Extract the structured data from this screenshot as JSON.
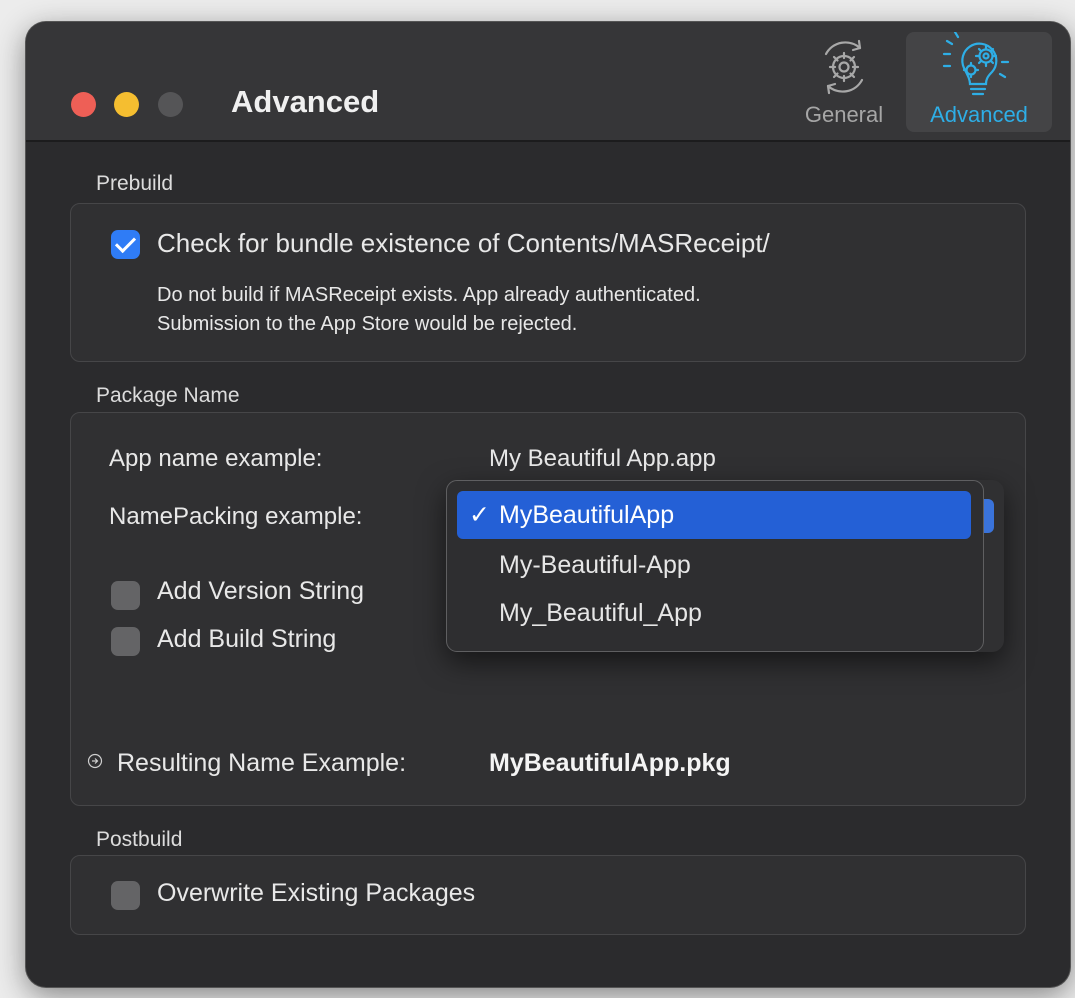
{
  "window": {
    "title": "Advanced",
    "toolbar": [
      {
        "label": "General",
        "icon": "gear-cycle-icon",
        "selected": false
      },
      {
        "label": "Advanced",
        "icon": "lightbulb-gears-icon",
        "selected": true
      }
    ],
    "accent": "#2eaee6"
  },
  "prebuild": {
    "section_label": "Prebuild",
    "check_bundle": {
      "label": "Check for bundle existence of Contents/MASReceipt/",
      "checked": true
    },
    "description_line1": "Do not build if MASReceipt exists. App already authenticated.",
    "description_line2": "Submission to the App Store would be rejected."
  },
  "package_name": {
    "section_label": "Package Name",
    "app_name_label": "App name example:",
    "app_name_value": "My Beautiful App.app",
    "name_packing_label": "NamePacking example:",
    "name_packing_options": [
      {
        "label": "MyBeautifulApp",
        "selected": true
      },
      {
        "label": "My-Beautiful-App",
        "selected": false
      },
      {
        "label": "My_Beautiful_App",
        "selected": false
      }
    ],
    "checkmark": "✓",
    "add_version": {
      "label": "Add Version String",
      "checked": false
    },
    "add_build": {
      "label": "Add Build String",
      "checked": false
    },
    "result_label": "Resulting Name Example:",
    "result_value": "MyBeautifulApp.pkg"
  },
  "postbuild": {
    "section_label": "Postbuild",
    "overwrite": {
      "label": "Overwrite Existing Packages",
      "checked": false
    }
  }
}
